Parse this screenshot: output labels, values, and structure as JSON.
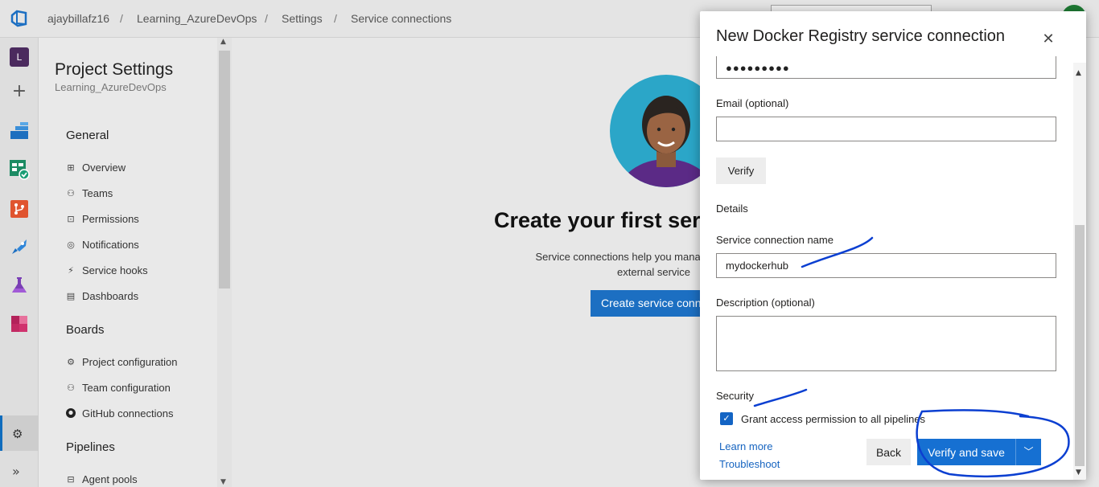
{
  "breadcrumb": {
    "org": "ajaybillafz16",
    "project": "Learning_AzureDevOps",
    "settings": "Settings",
    "page": "Service connections"
  },
  "rail": {
    "project_initial": "L"
  },
  "settings_nav": {
    "title": "Project Settings",
    "project": "Learning_AzureDevOps",
    "general": {
      "heading": "General",
      "items": [
        "Overview",
        "Teams",
        "Permissions",
        "Notifications",
        "Service hooks",
        "Dashboards"
      ]
    },
    "boards": {
      "heading": "Boards",
      "items": [
        "Project configuration",
        "Team configuration",
        "GitHub connections"
      ]
    },
    "pipelines": {
      "heading": "Pipelines",
      "items": [
        "Agent pools"
      ]
    }
  },
  "main": {
    "title": "Create your first servi",
    "description_line1": "Service connections help you manage, protec",
    "description_line2": "external service",
    "create_button": "Create service conn"
  },
  "dialog": {
    "title": "New Docker Registry service connection",
    "password_mask": "●●●●●●●●●",
    "email_label": "Email (optional)",
    "email_value": "",
    "verify_button": "Verify",
    "details_heading": "Details",
    "name_label": "Service connection name",
    "name_value": "mydockerhub",
    "description_label": "Description (optional)",
    "description_value": "",
    "security_heading": "Security",
    "grant_access_label": "Grant access permission to all pipelines",
    "grant_access_checked": true,
    "learn_more": "Learn more",
    "troubleshoot": "Troubleshoot",
    "back_button": "Back",
    "save_button": "Verify and save"
  },
  "colors": {
    "accent": "#1670d2",
    "link": "#1664c0",
    "annotation_ink": "#0b3fd1"
  }
}
